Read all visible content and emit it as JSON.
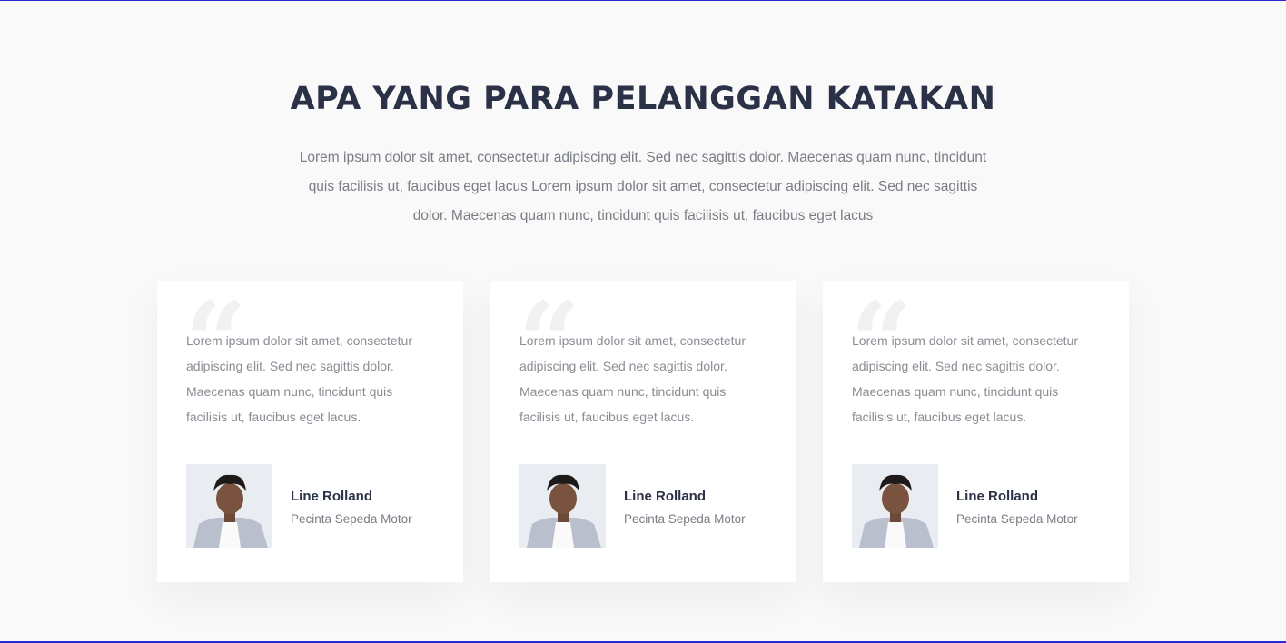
{
  "section": {
    "title": "APA YANG PARA PELANGGAN KATAKAN",
    "description": "Lorem ipsum dolor sit amet, consectetur adipiscing elit. Sed nec sagittis dolor. Maecenas quam nunc, tincidunt quis facilisis ut, faucibus eget lacus Lorem ipsum dolor sit amet, consectetur adipiscing elit. Sed nec sagittis dolor. Maecenas quam nunc, tincidunt quis facilisis ut, faucibus eget lacus"
  },
  "testimonials": [
    {
      "quote_icon": "quote-icon",
      "text": "Lorem ipsum dolor sit amet, consectetur adipiscing elit. Sed nec sagittis dolor. Maecenas quam nunc, tincidunt quis facilisis ut, faucibus eget lacus.",
      "author_name": "Line Rolland",
      "author_role": "Pecinta Sepeda Motor"
    },
    {
      "quote_icon": "quote-icon",
      "text": "Lorem ipsum dolor sit amet, consectetur adipiscing elit. Sed nec sagittis dolor. Maecenas quam nunc, tincidunt quis facilisis ut, faucibus eget lacus.",
      "author_name": "Line Rolland",
      "author_role": "Pecinta Sepeda Motor"
    },
    {
      "quote_icon": "quote-icon",
      "text": "Lorem ipsum dolor sit amet, consectetur adipiscing elit. Sed nec sagittis dolor. Maecenas quam nunc, tincidunt quis facilisis ut, faucibus eget lacus.",
      "author_name": "Line Rolland",
      "author_role": "Pecinta Sepeda Motor"
    }
  ],
  "colors": {
    "title": "#2b3146",
    "body_text": "#7a7d86",
    "page_background": "#f9f9fa",
    "card_background": "#ffffff",
    "border_accent": "#2a2ad4"
  }
}
